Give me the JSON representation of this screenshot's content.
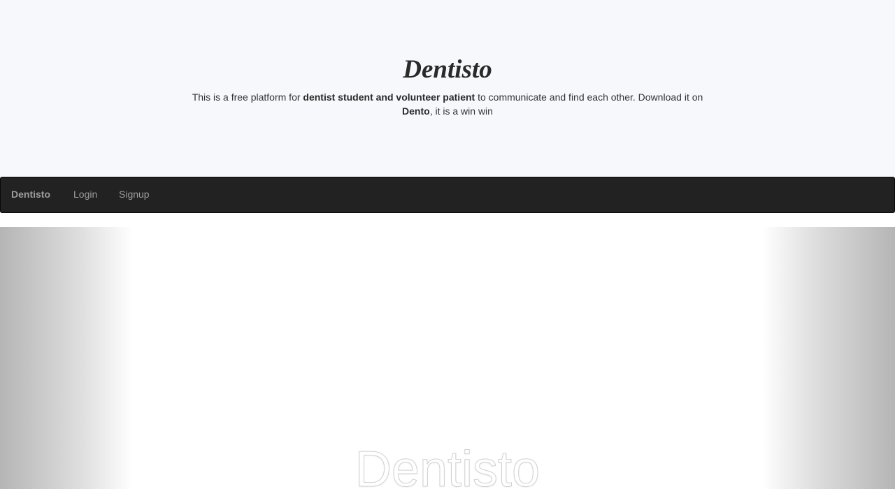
{
  "hero": {
    "title": "Dentisto",
    "description": {
      "part1": "This is a free platform for ",
      "bold1": "dentist student and volunteer patient",
      "part2": " to communicate and find each other. Download it on ",
      "bold2": "Dento",
      "part3": ", it is a win win"
    }
  },
  "navbar": {
    "brand": "Dentisto",
    "links": [
      {
        "label": "Login"
      },
      {
        "label": "Signup"
      }
    ]
  },
  "showcase": {
    "text": "Dentisto"
  }
}
